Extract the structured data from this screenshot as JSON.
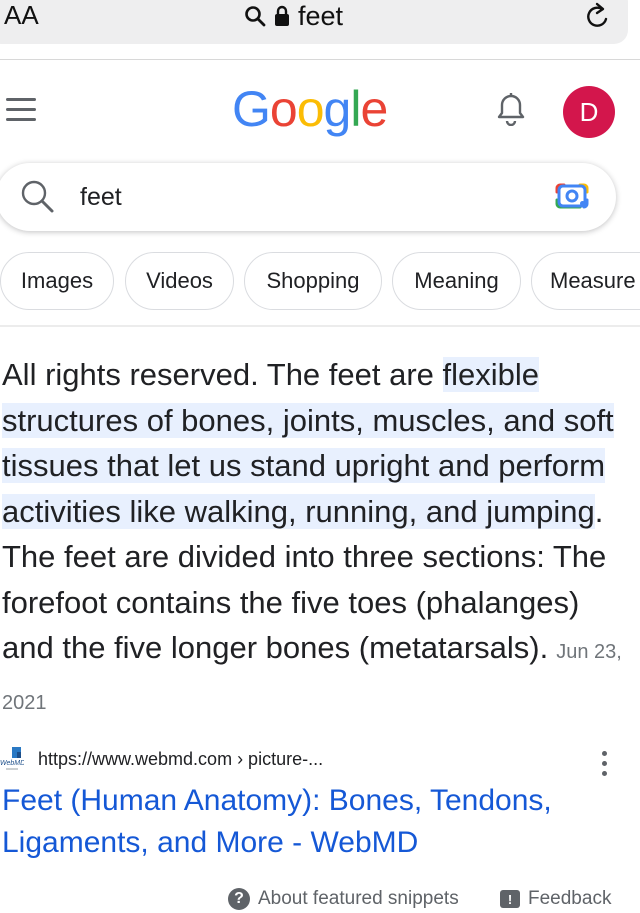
{
  "browser": {
    "text_size_label": "AA",
    "url": "feet"
  },
  "google": {
    "logo_letters": [
      {
        "char": "G",
        "color": "#4285F4"
      },
      {
        "char": "o",
        "color": "#EA4335"
      },
      {
        "char": "o",
        "color": "#FBBC05"
      },
      {
        "char": "g",
        "color": "#4285F4"
      },
      {
        "char": "l",
        "color": "#34A853"
      },
      {
        "char": "e",
        "color": "#EA4335"
      }
    ],
    "avatar_initial": "D",
    "avatar_color": "#D3164C"
  },
  "search": {
    "query": "feet"
  },
  "chips": [
    "Images",
    "Videos",
    "Shopping",
    "Meaning",
    "Measure"
  ],
  "snippet": {
    "prefix": "All rights reserved. The feet are ",
    "highlight": "flexible structures of bones, joints, muscles, and soft tissues that let us stand upright and perform activities like walking, running, and jumping",
    "suffix": ". The feet are divided into three sections: The forefoot contains the five toes (phalanges) and the five longer bones (metatarsals).",
    "date": "Jun 23, 2021"
  },
  "source": {
    "favicon_label": "WebMD",
    "url": "https://www.webmd.com › picture-..."
  },
  "result": {
    "title": "Feet (Human Anatomy): Bones, Tendons, Ligaments, and More - WebMD"
  },
  "footer": {
    "about": "About featured snippets",
    "feedback": "Feedback"
  },
  "colors": {
    "link": "#1558D6",
    "highlight_bg": "#E8F0FE",
    "meta_text": "#70757A"
  },
  "icons": {
    "search": "search-icon",
    "lock": "lock-icon",
    "reload": "reload-icon",
    "menu": "hamburger-menu-icon",
    "notifications": "bell-icon",
    "lens": "google-lens-icon",
    "more": "more-vert-icon",
    "help": "help-circle-icon",
    "feedback": "feedback-icon"
  }
}
